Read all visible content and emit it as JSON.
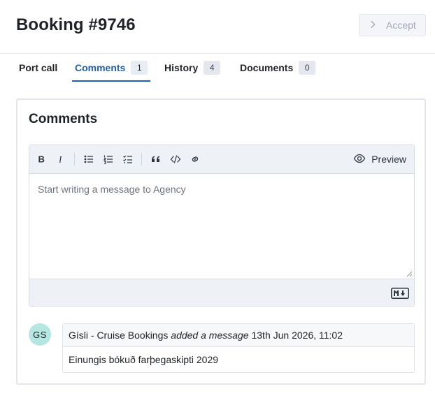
{
  "header": {
    "title": "Booking #9746",
    "accept_label": "Accept"
  },
  "tabs": [
    {
      "label": "Port call",
      "count": null,
      "active": false
    },
    {
      "label": "Comments",
      "count": "1",
      "active": true
    },
    {
      "label": "History",
      "count": "4",
      "active": false
    },
    {
      "label": "Documents",
      "count": "0",
      "active": false
    }
  ],
  "comments_panel": {
    "title": "Comments",
    "editor": {
      "toolbar": [
        "bold-icon",
        "italic-icon",
        "bulleted-list-icon",
        "numbered-list-icon",
        "task-list-icon",
        "quote-icon",
        "code-icon",
        "link-icon"
      ],
      "preview_label": "Preview",
      "placeholder": "Start writing a message to Agency",
      "value": "",
      "footer_icon": "markdown-icon"
    },
    "messages": [
      {
        "avatar_initials": "GS",
        "author": "Gísli - Cruise Bookings",
        "action": "added a message",
        "timestamp": "13th Jun 2026, 11:02",
        "body": "Einungis bókuð farþegaskipti 2029"
      }
    ]
  },
  "colors": {
    "accent": "#1f5fb4",
    "avatar_bg": "#b6e6e1",
    "toolbar_bg": "#eef1f5"
  }
}
